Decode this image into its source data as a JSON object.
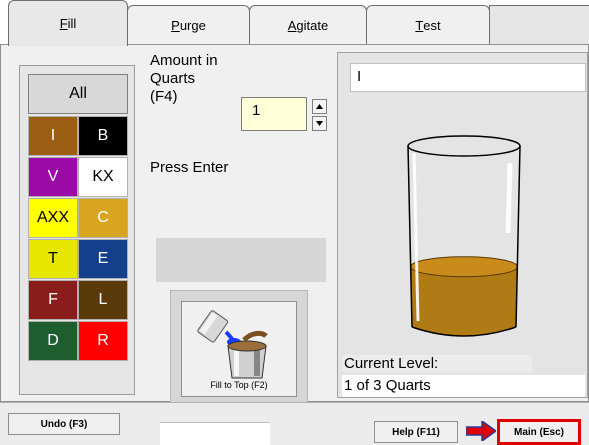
{
  "tabs": [
    {
      "key": "F",
      "rest": "ill"
    },
    {
      "key": "P",
      "rest": "urge"
    },
    {
      "key": "A",
      "rest": "gitate"
    },
    {
      "key": "T",
      "rest": "est"
    }
  ],
  "colors": {
    "all_label": "All",
    "cells": [
      {
        "label": "I",
        "bg": "#9b5e12",
        "fg": "#ffffff"
      },
      {
        "label": "B",
        "bg": "#000000",
        "fg": "#ffffff"
      },
      {
        "label": "V",
        "bg": "#9b0aa6",
        "fg": "#ffffff"
      },
      {
        "label": "KX",
        "bg": "#ffffff",
        "fg": "#000000"
      },
      {
        "label": "AXX",
        "bg": "#ffff00",
        "fg": "#000000"
      },
      {
        "label": "C",
        "bg": "#d9a520",
        "fg": "#ffffff"
      },
      {
        "label": "T",
        "bg": "#e6e600",
        "fg": "#000000"
      },
      {
        "label": "E",
        "bg": "#143f8a",
        "fg": "#ffffff"
      },
      {
        "label": "F",
        "bg": "#8b1c1c",
        "fg": "#ffffff"
      },
      {
        "label": "L",
        "bg": "#5a3a0a",
        "fg": "#ffffff"
      },
      {
        "label": "D",
        "bg": "#1e5e2e",
        "fg": "#ffffff"
      },
      {
        "label": "R",
        "bg": "#ff0000",
        "fg": "#ffffff"
      }
    ]
  },
  "amount": {
    "label_line1": "Amount in",
    "label_line2": "Quarts",
    "label_line3": "(F4)",
    "value": "1",
    "instruction": "Press Enter"
  },
  "fill_to_top": {
    "label": "Fill to Top (F2)"
  },
  "right_panel": {
    "top_field_value": "I",
    "current_level_label": "Current Level:",
    "current_level_value": "1 of 3 Quarts",
    "liquid_fill_fraction": 0.333,
    "liquid_color": "#b07a14"
  },
  "bottom": {
    "undo": "Undo (F3)",
    "help": "Help (F11)",
    "main": "Main (Esc)"
  }
}
